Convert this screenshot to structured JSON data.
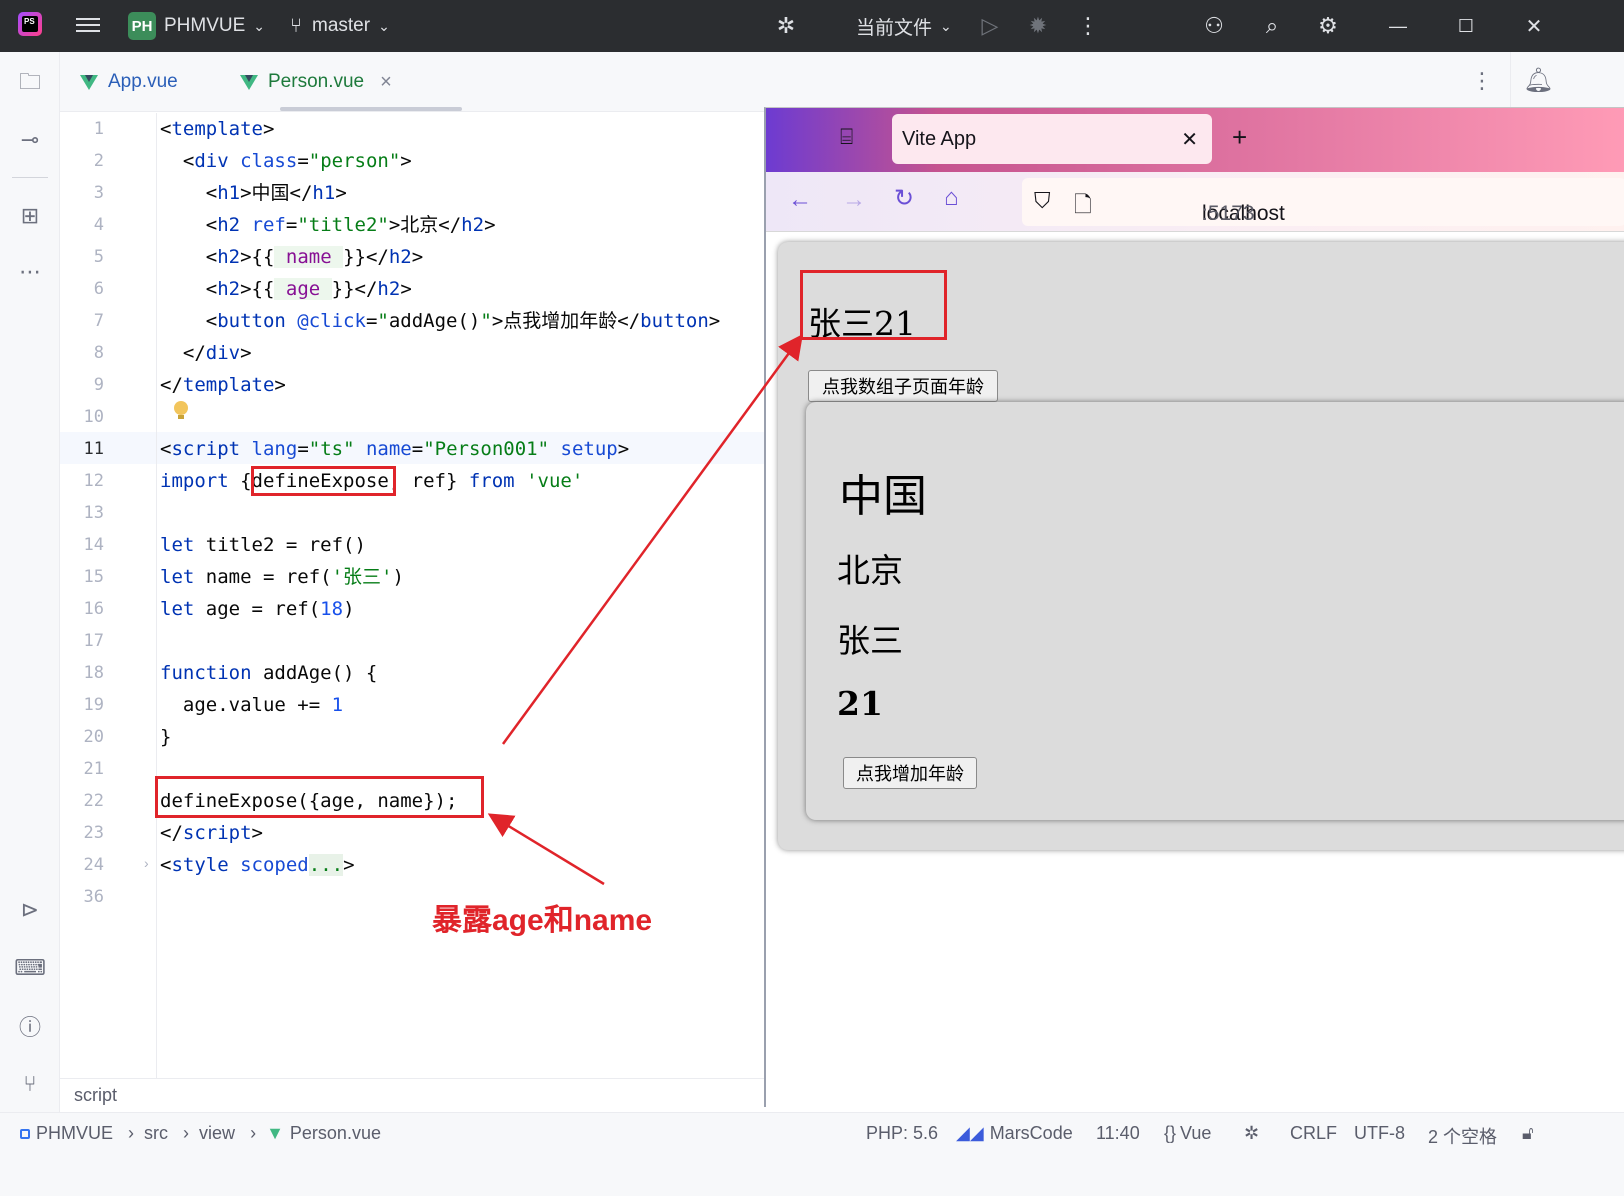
{
  "titlebar": {
    "project_badge": "PH",
    "project_name": "PHMVUE",
    "branch": "master",
    "run_config": "当前文件"
  },
  "tabs": [
    {
      "label": "App.vue",
      "active": false
    },
    {
      "label": "Person.vue",
      "active": true
    }
  ],
  "editor": {
    "line_numbers": [
      "1",
      "2",
      "3",
      "4",
      "5",
      "6",
      "7",
      "8",
      "9",
      "10",
      "11",
      "12",
      "13",
      "14",
      "15",
      "16",
      "17",
      "18",
      "19",
      "20",
      "21",
      "22",
      "23",
      "24",
      "36"
    ],
    "current_line": "11",
    "breadcrumb": "script"
  },
  "browser": {
    "tab_title": "Vite App",
    "url_host": "localhost",
    "url_port": ":5173",
    "parent_title": "张三21",
    "parent_button": "点我数组子页面年龄",
    "child_h1": "中国",
    "child_h2_city": "北京",
    "child_h2_name": "张三",
    "child_h2_age": "21",
    "child_button": "点我增加年龄"
  },
  "annotation": {
    "label": "暴露age和name",
    "color": "#e0242a"
  },
  "statusbar": {
    "path": [
      "PHMVUE",
      "src",
      "view",
      "Person.vue"
    ],
    "php": "PHP: 5.6",
    "marscode": "MarsCode",
    "position": "11:40",
    "language": "Vue",
    "line_sep": "CRLF",
    "encoding": "UTF-8",
    "indent": "2 个空格"
  },
  "colors": {
    "keyword": "#0033b3",
    "string": "#067d17",
    "number": "#1750eb",
    "variable": "#871094",
    "vue_green": "#41b883"
  }
}
